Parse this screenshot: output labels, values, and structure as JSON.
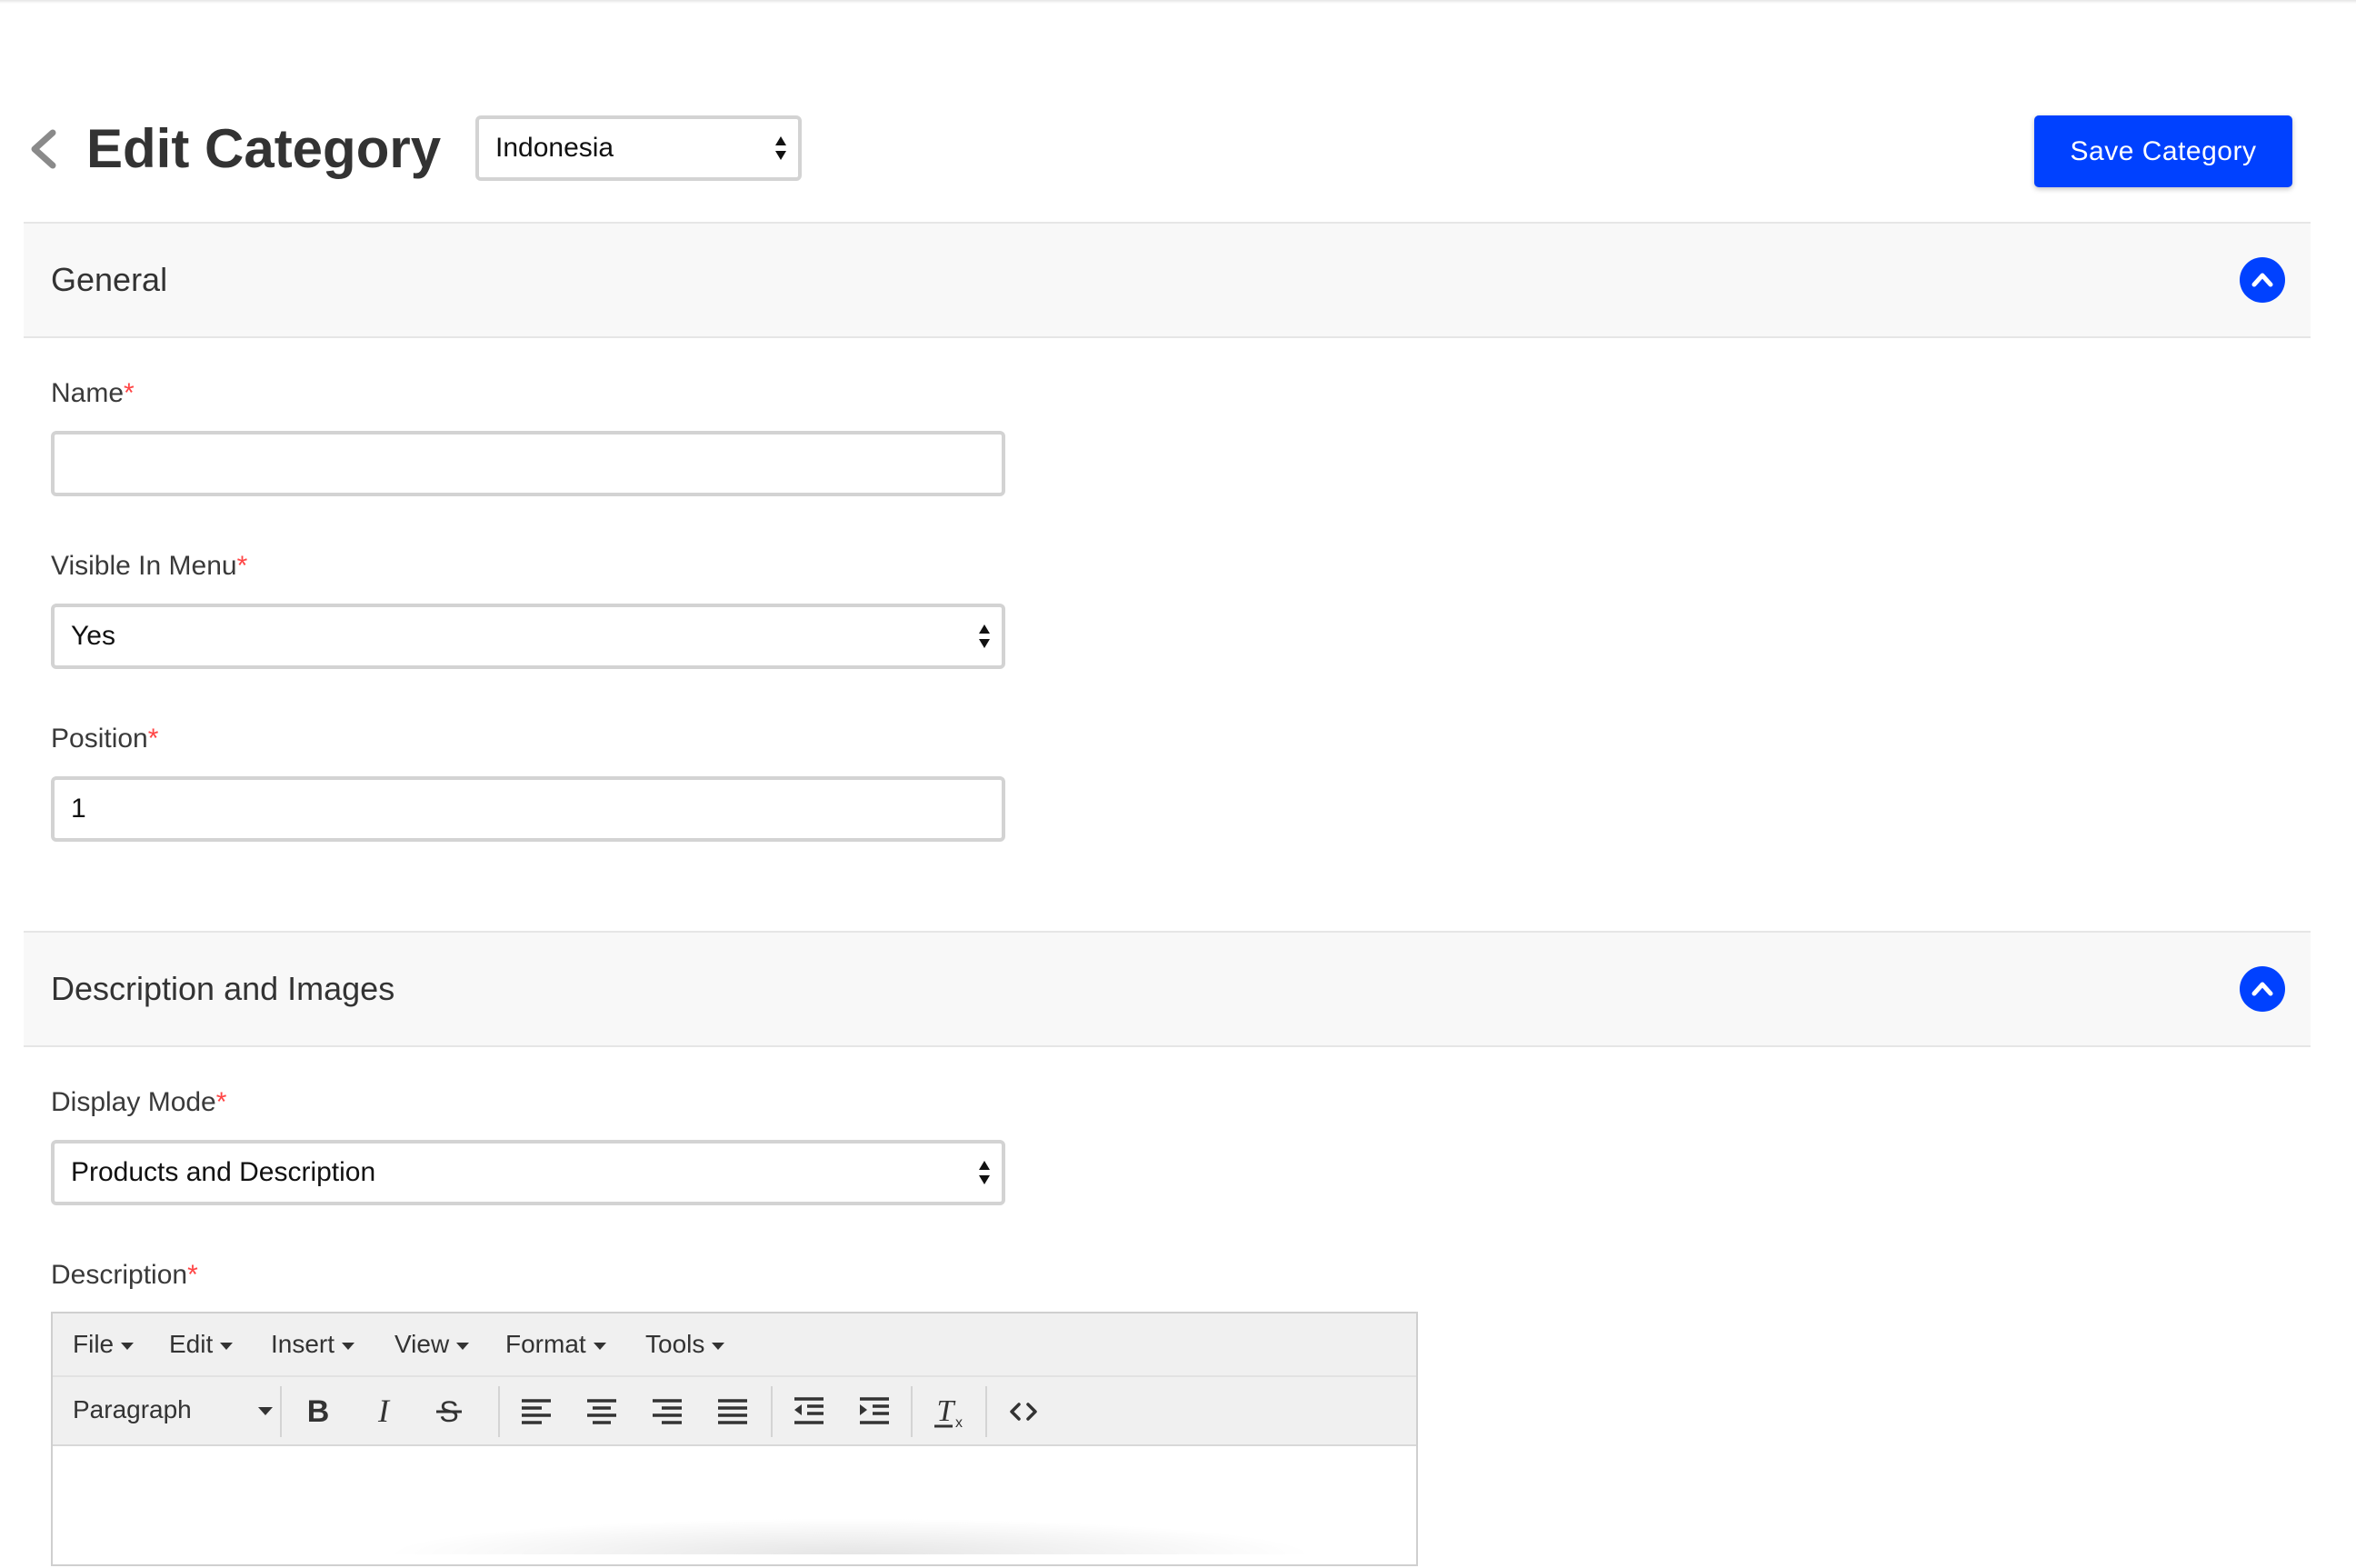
{
  "header": {
    "title": "Edit Category",
    "locale_value": "Indonesia",
    "save_label": "Save Category",
    "back_icon": "chevron-left-icon"
  },
  "sections": {
    "general": {
      "title": "General",
      "collapse_icon": "chevron-up-icon"
    },
    "description_images": {
      "title": "Description and Images",
      "collapse_icon": "chevron-up-icon"
    }
  },
  "fields": {
    "name": {
      "label": "Name",
      "required_mark": "*",
      "value": ""
    },
    "visible_in_menu": {
      "label": "Visible In Menu",
      "required_mark": "*",
      "value": "Yes"
    },
    "position": {
      "label": "Position",
      "required_mark": "*",
      "value": "1"
    },
    "display_mode": {
      "label": "Display Mode",
      "required_mark": "*",
      "value": "Products and Description"
    },
    "description": {
      "label": "Description",
      "required_mark": "*"
    }
  },
  "editor": {
    "menu": [
      "File",
      "Edit",
      "Insert",
      "View",
      "Format",
      "Tools"
    ],
    "block_format": "Paragraph",
    "toolbar_icons": [
      "bold-icon",
      "italic-icon",
      "strikethrough-icon",
      "align-left-icon",
      "align-center-icon",
      "align-right-icon",
      "align-justify-icon",
      "outdent-icon",
      "indent-icon",
      "clear-formatting-icon",
      "source-code-icon"
    ]
  },
  "colors": {
    "accent": "#0041ff",
    "required": "#ff4545",
    "section_bg": "#f8f8f8",
    "input_border": "#d3d3d3"
  }
}
